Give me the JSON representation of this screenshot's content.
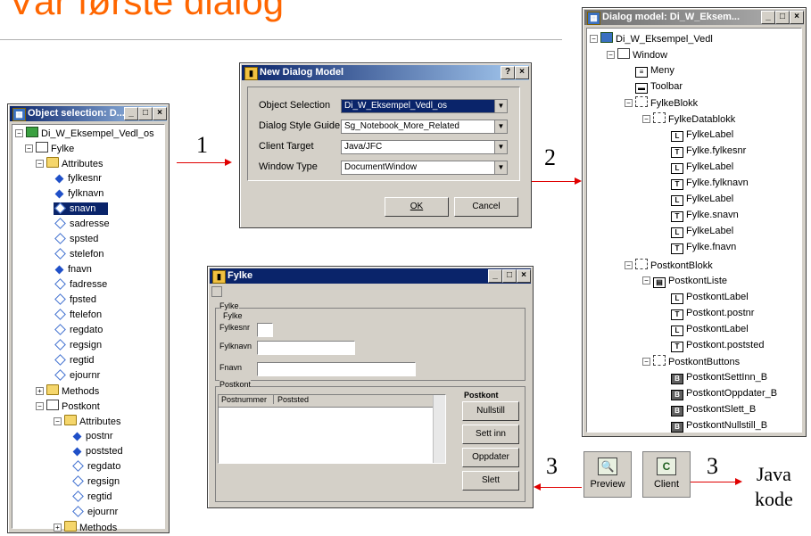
{
  "slide": {
    "title": "Vår første dialog",
    "step1": "1",
    "step2": "2",
    "step3a": "3",
    "step3b": "3",
    "java_line1": "Java",
    "java_line2": "kode"
  },
  "object_selection": {
    "title": "Object selection: D...",
    "items": [
      "Di_W_Eksempel_Vedl_os",
      "Fylke",
      "Attributes",
      "fylkesnr",
      "fylknavn",
      "snavn",
      "sadresse",
      "spsted",
      "stelefon",
      "fnavn",
      "fadresse",
      "fpsted",
      "ftelefon",
      "regdato",
      "regsign",
      "regtid",
      "ejournr",
      "Methods",
      "Postkont",
      "Attributes",
      "postnr",
      "poststed",
      "regdato",
      "regsign",
      "regtid",
      "ejournr",
      "Methods"
    ]
  },
  "new_dialog": {
    "title": "New Dialog Model",
    "help_btn": "?",
    "close_btn": "×",
    "object_selection_label": "Object Selection",
    "object_selection_value": "Di_W_Eksempel_Vedl_os",
    "style_guide_label": "Dialog Style Guide",
    "style_guide_value": "Sg_Notebook_More_Related",
    "client_target_label": "Client Target",
    "client_target_value": "Java/JFC",
    "window_type_label": "Window Type",
    "window_type_value": "DocumentWindow",
    "ok_label": "OK",
    "cancel_label": "Cancel"
  },
  "dialog_model": {
    "title": "Dialog model: Di_W_Eksem...",
    "items": [
      "Di_W_Eksempel_Vedl",
      "Window",
      "Meny",
      "Toolbar",
      "FylkeBlokk",
      "FylkeDatablokk",
      "FylkeLabel",
      "Fylke.fylkesnr",
      "FylkeLabel",
      "Fylke.fylknavn",
      "FylkeLabel",
      "Fylke.snavn",
      "FylkeLabel",
      "Fylke.fnavn",
      "PostkontBlokk",
      "PostkontListe",
      "PostkontLabel",
      "Postkont.postnr",
      "PostkontLabel",
      "Postkont.poststed",
      "PostkontButtons",
      "PostkontSettInn_B",
      "PostkontOppdater_B",
      "PostkontSlett_B",
      "PostkontNullstill_B"
    ]
  },
  "fylke_window": {
    "title": "Fylke",
    "group_fylke": "Fylke",
    "group_fylke_inner": "Fylke",
    "fylkesnr_label": "Fylkesnr",
    "fylknavn_label": "Fylknavn",
    "fnavn_label": "Fnavn",
    "group_postkont": "Postkont",
    "col_postnummer": "Postnummer",
    "col_poststed": "Poststed",
    "buttons_group": "Postkont",
    "btn_nullstill": "Nullstill",
    "btn_settinn": "Sett inn",
    "btn_oppdater": "Oppdater",
    "btn_slett": "Slett"
  },
  "toolbar": {
    "preview_label": "Preview",
    "client_label": "Client"
  },
  "colors": {
    "title_color": "#ff6600",
    "arrow_color": "#e00000",
    "titlebar_active": "#0a246a"
  }
}
